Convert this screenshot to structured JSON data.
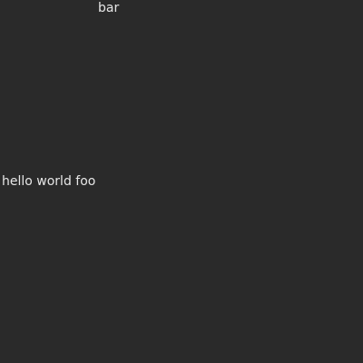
{
  "labels": {
    "top": "bar",
    "middle": "hello world foo"
  },
  "colors": {
    "background": "#2a2a2a",
    "text": "#e6e6e6"
  }
}
